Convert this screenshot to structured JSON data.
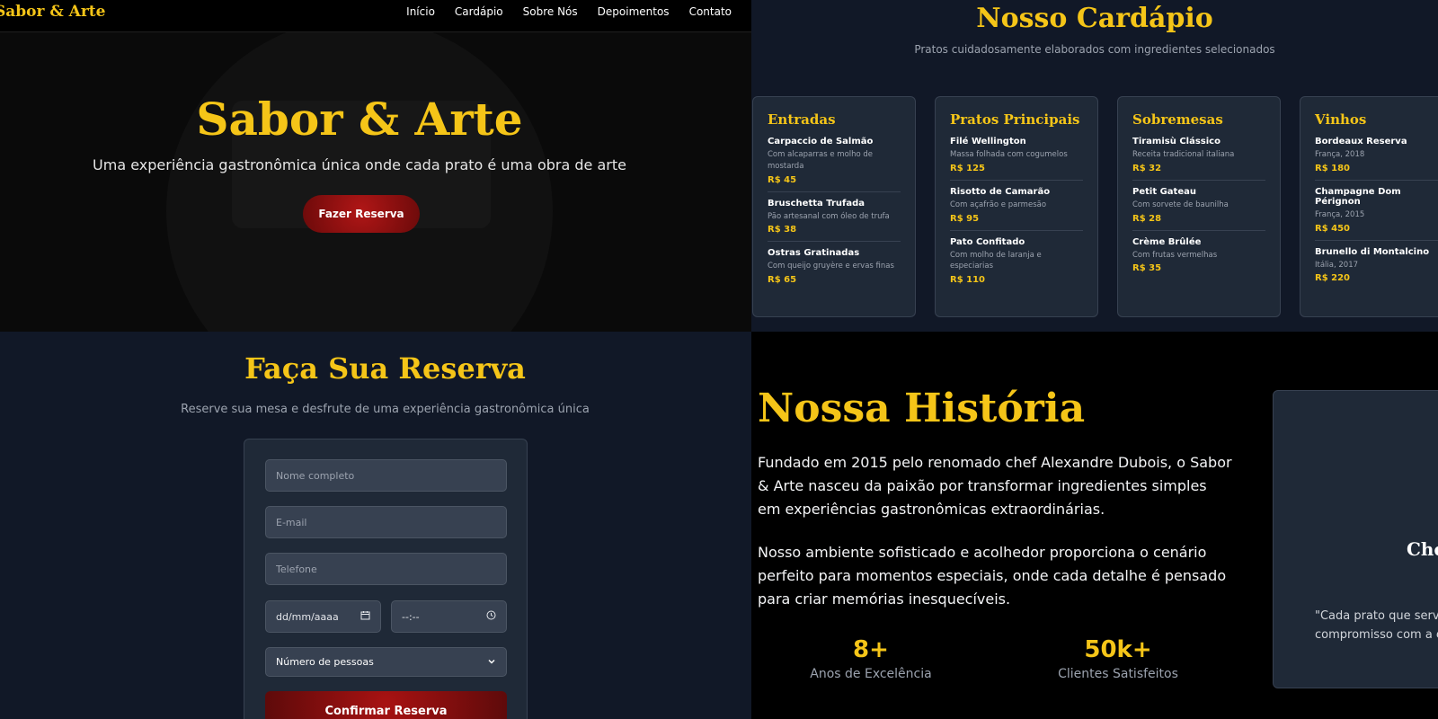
{
  "nav": {
    "brand": "Sabor & Arte",
    "links": [
      "Início",
      "Cardápio",
      "Sobre Nós",
      "Depoimentos",
      "Contato"
    ]
  },
  "hero": {
    "title": "Sabor & Arte",
    "subtitle": "Uma experiência gastronômica única onde cada prato é uma obra de arte",
    "cta": "Fazer Reserva"
  },
  "menu": {
    "title": "Nosso Cardápio",
    "subtitle": "Pratos cuidadosamente elaborados com ingredientes selecionados",
    "categories": [
      {
        "name": "Entradas",
        "items": [
          {
            "name": "Carpaccio de Salmão",
            "desc": "Com alcaparras e molho de mostarda",
            "price": "R$ 45"
          },
          {
            "name": "Bruschetta Trufada",
            "desc": "Pão artesanal com óleo de trufa",
            "price": "R$ 38"
          },
          {
            "name": "Ostras Gratinadas",
            "desc": "Com queijo gruyère e ervas finas",
            "price": "R$ 65"
          }
        ]
      },
      {
        "name": "Pratos Principais",
        "items": [
          {
            "name": "Filé Wellington",
            "desc": "Massa folhada com cogumelos",
            "price": "R$ 125"
          },
          {
            "name": "Risotto de Camarão",
            "desc": "Com açafrão e parmesão",
            "price": "R$ 95"
          },
          {
            "name": "Pato Confitado",
            "desc": "Com molho de laranja e especiarias",
            "price": "R$ 110"
          }
        ]
      },
      {
        "name": "Sobremesas",
        "items": [
          {
            "name": "Tiramisù Clássico",
            "desc": "Receita tradicional italiana",
            "price": "R$ 32"
          },
          {
            "name": "Petit Gateau",
            "desc": "Com sorvete de baunilha",
            "price": "R$ 28"
          },
          {
            "name": "Crème Brûlée",
            "desc": "Com frutas vermelhas",
            "price": "R$ 35"
          }
        ]
      },
      {
        "name": "Vinhos",
        "items": [
          {
            "name": "Bordeaux Reserva",
            "desc": "França, 2018",
            "price": "R$ 180"
          },
          {
            "name": "Champagne Dom Pérignon",
            "desc": "França, 2015",
            "price": "R$ 450"
          },
          {
            "name": "Brunello di Montalcino",
            "desc": "Itália, 2017",
            "price": "R$ 220"
          }
        ]
      }
    ]
  },
  "reservation": {
    "title": "Faça Sua Reserva",
    "subtitle": "Reserve sua mesa e desfrute de uma experiência gastronômica única",
    "name_placeholder": "Nome completo",
    "email_placeholder": "E-mail",
    "phone_placeholder": "Telefone",
    "date_value": "dd/mm/aaaa",
    "time_value": "--:--",
    "guests_selected": "Número de pessoas",
    "submit": "Confirmar Reserva"
  },
  "history": {
    "title": "Nossa História",
    "p1": "Fundado em 2015 pelo renomado chef Alexandre Dubois, o Sabor & Arte nasceu da paixão por transformar ingredientes simples em experiências gastronômicas extraordinárias.",
    "p2": "Nosso ambiente sofisticado e acolhedor proporciona o cenário perfeito para momentos especiais, onde cada detalhe é pensado para criar memórias inesquecíveis.",
    "stats": [
      {
        "num": "8+",
        "label": "Anos de Excelência"
      },
      {
        "num": "50k+",
        "label": "Clientes Satisfeitos"
      }
    ],
    "chef_name_partial": "Che",
    "quote_line1": "\"Cada prato que serv",
    "quote_line2": "compromisso com a ex"
  },
  "colors": {
    "gold": "#f5c518",
    "crimson": "#a81212",
    "panel": "#1f2937",
    "bg_dark": "#111827"
  }
}
